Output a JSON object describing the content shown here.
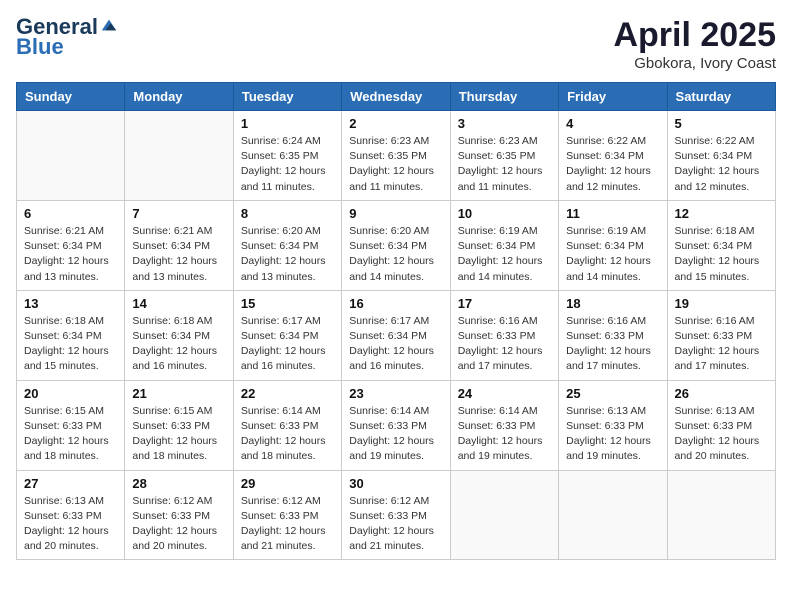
{
  "logo": {
    "general": "General",
    "blue": "Blue"
  },
  "header": {
    "month": "April 2025",
    "location": "Gbokora, Ivory Coast"
  },
  "weekdays": [
    "Sunday",
    "Monday",
    "Tuesday",
    "Wednesday",
    "Thursday",
    "Friday",
    "Saturday"
  ],
  "weeks": [
    [
      {
        "day": "",
        "info": ""
      },
      {
        "day": "",
        "info": ""
      },
      {
        "day": "1",
        "info": "Sunrise: 6:24 AM\nSunset: 6:35 PM\nDaylight: 12 hours and 11 minutes."
      },
      {
        "day": "2",
        "info": "Sunrise: 6:23 AM\nSunset: 6:35 PM\nDaylight: 12 hours and 11 minutes."
      },
      {
        "day": "3",
        "info": "Sunrise: 6:23 AM\nSunset: 6:35 PM\nDaylight: 12 hours and 11 minutes."
      },
      {
        "day": "4",
        "info": "Sunrise: 6:22 AM\nSunset: 6:34 PM\nDaylight: 12 hours and 12 minutes."
      },
      {
        "day": "5",
        "info": "Sunrise: 6:22 AM\nSunset: 6:34 PM\nDaylight: 12 hours and 12 minutes."
      }
    ],
    [
      {
        "day": "6",
        "info": "Sunrise: 6:21 AM\nSunset: 6:34 PM\nDaylight: 12 hours and 13 minutes."
      },
      {
        "day": "7",
        "info": "Sunrise: 6:21 AM\nSunset: 6:34 PM\nDaylight: 12 hours and 13 minutes."
      },
      {
        "day": "8",
        "info": "Sunrise: 6:20 AM\nSunset: 6:34 PM\nDaylight: 12 hours and 13 minutes."
      },
      {
        "day": "9",
        "info": "Sunrise: 6:20 AM\nSunset: 6:34 PM\nDaylight: 12 hours and 14 minutes."
      },
      {
        "day": "10",
        "info": "Sunrise: 6:19 AM\nSunset: 6:34 PM\nDaylight: 12 hours and 14 minutes."
      },
      {
        "day": "11",
        "info": "Sunrise: 6:19 AM\nSunset: 6:34 PM\nDaylight: 12 hours and 14 minutes."
      },
      {
        "day": "12",
        "info": "Sunrise: 6:18 AM\nSunset: 6:34 PM\nDaylight: 12 hours and 15 minutes."
      }
    ],
    [
      {
        "day": "13",
        "info": "Sunrise: 6:18 AM\nSunset: 6:34 PM\nDaylight: 12 hours and 15 minutes."
      },
      {
        "day": "14",
        "info": "Sunrise: 6:18 AM\nSunset: 6:34 PM\nDaylight: 12 hours and 16 minutes."
      },
      {
        "day": "15",
        "info": "Sunrise: 6:17 AM\nSunset: 6:34 PM\nDaylight: 12 hours and 16 minutes."
      },
      {
        "day": "16",
        "info": "Sunrise: 6:17 AM\nSunset: 6:34 PM\nDaylight: 12 hours and 16 minutes."
      },
      {
        "day": "17",
        "info": "Sunrise: 6:16 AM\nSunset: 6:33 PM\nDaylight: 12 hours and 17 minutes."
      },
      {
        "day": "18",
        "info": "Sunrise: 6:16 AM\nSunset: 6:33 PM\nDaylight: 12 hours and 17 minutes."
      },
      {
        "day": "19",
        "info": "Sunrise: 6:16 AM\nSunset: 6:33 PM\nDaylight: 12 hours and 17 minutes."
      }
    ],
    [
      {
        "day": "20",
        "info": "Sunrise: 6:15 AM\nSunset: 6:33 PM\nDaylight: 12 hours and 18 minutes."
      },
      {
        "day": "21",
        "info": "Sunrise: 6:15 AM\nSunset: 6:33 PM\nDaylight: 12 hours and 18 minutes."
      },
      {
        "day": "22",
        "info": "Sunrise: 6:14 AM\nSunset: 6:33 PM\nDaylight: 12 hours and 18 minutes."
      },
      {
        "day": "23",
        "info": "Sunrise: 6:14 AM\nSunset: 6:33 PM\nDaylight: 12 hours and 19 minutes."
      },
      {
        "day": "24",
        "info": "Sunrise: 6:14 AM\nSunset: 6:33 PM\nDaylight: 12 hours and 19 minutes."
      },
      {
        "day": "25",
        "info": "Sunrise: 6:13 AM\nSunset: 6:33 PM\nDaylight: 12 hours and 19 minutes."
      },
      {
        "day": "26",
        "info": "Sunrise: 6:13 AM\nSunset: 6:33 PM\nDaylight: 12 hours and 20 minutes."
      }
    ],
    [
      {
        "day": "27",
        "info": "Sunrise: 6:13 AM\nSunset: 6:33 PM\nDaylight: 12 hours and 20 minutes."
      },
      {
        "day": "28",
        "info": "Sunrise: 6:12 AM\nSunset: 6:33 PM\nDaylight: 12 hours and 20 minutes."
      },
      {
        "day": "29",
        "info": "Sunrise: 6:12 AM\nSunset: 6:33 PM\nDaylight: 12 hours and 21 minutes."
      },
      {
        "day": "30",
        "info": "Sunrise: 6:12 AM\nSunset: 6:33 PM\nDaylight: 12 hours and 21 minutes."
      },
      {
        "day": "",
        "info": ""
      },
      {
        "day": "",
        "info": ""
      },
      {
        "day": "",
        "info": ""
      }
    ]
  ]
}
